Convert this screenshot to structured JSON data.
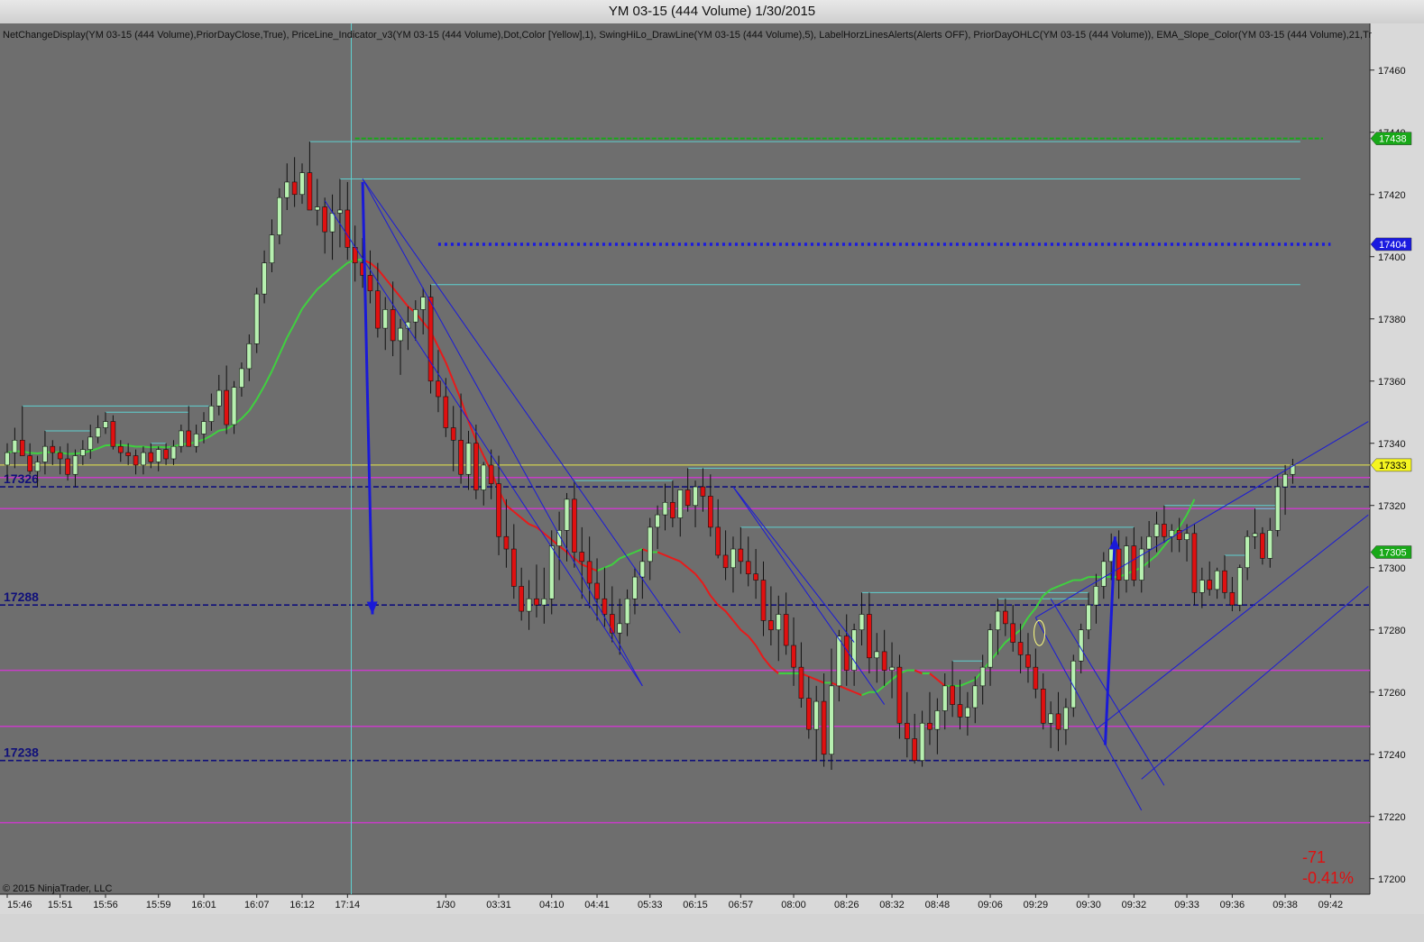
{
  "window": {
    "title": "YM 03-15 (444 Volume)  1/30/2015"
  },
  "indicator_label": "NetChangeDisplay(YM 03-15 (444 Volume),PriorDayClose,True), PriceLine_Indicator_v3(YM 03-15 (444 Volume),Dot,Color [Yellow],1), SwingHiLo_DrawLine(YM 03-15 (444 Volume),5), LabelHorzLinesAlerts(Alerts OFF), PriorDayOHLC(YM 03-15 (444 Volume)), EMA_Slope_Color(YM 03-15 (444 Volume),21,Tr",
  "copyright": "© 2015 NinjaTrader, LLC",
  "net_change": {
    "points": "-71",
    "percent": "-0.41%"
  },
  "colors": {
    "background": "#6e6e6e",
    "up_candle": "#b7f0b0",
    "down_candle": "#e01010",
    "wick": "#111111",
    "ema_up": "#3fd13f",
    "ema_down": "#e81a1a",
    "level_line": "#10107a",
    "prior_day": "#c83cc8",
    "swing": "#5fd0d0",
    "channel": "#1a1ad8",
    "price_line": "#e8e84a",
    "green_dash": "#18a818",
    "blue_dot": "#1a1ae0"
  },
  "chart_data": {
    "type": "candlestick",
    "title": "YM 03-15 (444 Volume)  1/30/2015",
    "ylim": [
      17195,
      17475
    ],
    "y_ticks": [
      17200,
      17220,
      17240,
      17260,
      17280,
      17300,
      17320,
      17340,
      17360,
      17380,
      17400,
      17420,
      17440,
      17460
    ],
    "x_labels": [
      {
        "i": 0,
        "label": "15:46"
      },
      {
        "i": 7,
        "label": "15:51"
      },
      {
        "i": 13,
        "label": "15:56"
      },
      {
        "i": 20,
        "label": "15:59"
      },
      {
        "i": 26,
        "label": "16:01"
      },
      {
        "i": 33,
        "label": "16:07"
      },
      {
        "i": 39,
        "label": "16:12"
      },
      {
        "i": 45,
        "label": "17:14"
      },
      {
        "i": 58,
        "label": "1/30"
      },
      {
        "i": 65,
        "label": "03:31"
      },
      {
        "i": 72,
        "label": "04:10"
      },
      {
        "i": 78,
        "label": "04:41"
      },
      {
        "i": 85,
        "label": "05:33"
      },
      {
        "i": 91,
        "label": "06:15"
      },
      {
        "i": 97,
        "label": "06:57"
      },
      {
        "i": 104,
        "label": "08:00"
      },
      {
        "i": 111,
        "label": "08:26"
      },
      {
        "i": 117,
        "label": "08:32"
      },
      {
        "i": 123,
        "label": "08:48"
      },
      {
        "i": 130,
        "label": "09:06"
      },
      {
        "i": 136,
        "label": "09:29"
      },
      {
        "i": 143,
        "label": "09:30"
      },
      {
        "i": 149,
        "label": "09:32"
      },
      {
        "i": 156,
        "label": "09:33"
      },
      {
        "i": 162,
        "label": "09:36"
      },
      {
        "i": 169,
        "label": "09:38"
      },
      {
        "i": 175,
        "label": "09:42"
      }
    ],
    "candles": [
      [
        17333,
        17340,
        17328,
        17337
      ],
      [
        17337,
        17345,
        17332,
        17341
      ],
      [
        17341,
        17352,
        17338,
        17336
      ],
      [
        17336,
        17340,
        17330,
        17331
      ],
      [
        17331,
        17336,
        17326,
        17334
      ],
      [
        17334,
        17344,
        17330,
        17339
      ],
      [
        17339,
        17341,
        17333,
        17337
      ],
      [
        17337,
        17339,
        17330,
        17335
      ],
      [
        17335,
        17340,
        17328,
        17330
      ],
      [
        17330,
        17338,
        17326,
        17336
      ],
      [
        17336,
        17341,
        17333,
        17338
      ],
      [
        17338,
        17346,
        17335,
        17342
      ],
      [
        17342,
        17349,
        17340,
        17345
      ],
      [
        17345,
        17350,
        17343,
        17347
      ],
      [
        17347,
        17349,
        17338,
        17339
      ],
      [
        17339,
        17341,
        17334,
        17337
      ],
      [
        17337,
        17340,
        17333,
        17336
      ],
      [
        17336,
        17338,
        17330,
        17333
      ],
      [
        17333,
        17339,
        17330,
        17337
      ],
      [
        17337,
        17340,
        17332,
        17334
      ],
      [
        17334,
        17339,
        17331,
        17338
      ],
      [
        17338,
        17340,
        17333,
        17335
      ],
      [
        17335,
        17341,
        17333,
        17339
      ],
      [
        17339,
        17346,
        17337,
        17344
      ],
      [
        17344,
        17352,
        17341,
        17339
      ],
      [
        17339,
        17346,
        17337,
        17343
      ],
      [
        17343,
        17350,
        17340,
        17347
      ],
      [
        17347,
        17356,
        17344,
        17352
      ],
      [
        17352,
        17362,
        17349,
        17357
      ],
      [
        17357,
        17365,
        17343,
        17346
      ],
      [
        17346,
        17360,
        17343,
        17358
      ],
      [
        17358,
        17366,
        17355,
        17364
      ],
      [
        17364,
        17375,
        17360,
        17372
      ],
      [
        17372,
        17390,
        17369,
        17388
      ],
      [
        17388,
        17402,
        17385,
        17398
      ],
      [
        17398,
        17412,
        17395,
        17407
      ],
      [
        17407,
        17422,
        17404,
        17419
      ],
      [
        17419,
        17430,
        17415,
        17424
      ],
      [
        17424,
        17432,
        17416,
        17420
      ],
      [
        17420,
        17430,
        17417,
        17427
      ],
      [
        17427,
        17437,
        17420,
        17415
      ],
      [
        17415,
        17425,
        17410,
        17416
      ],
      [
        17416,
        17419,
        17401,
        17408
      ],
      [
        17408,
        17420,
        17399,
        17414
      ],
      [
        17414,
        17425,
        17403,
        17415
      ],
      [
        17415,
        17424,
        17399,
        17403
      ],
      [
        17403,
        17410,
        17392,
        17398
      ],
      [
        17398,
        17406,
        17390,
        17394
      ],
      [
        17394,
        17402,
        17385,
        17389
      ],
      [
        17389,
        17398,
        17374,
        17377
      ],
      [
        17377,
        17387,
        17370,
        17383
      ],
      [
        17383,
        17392,
        17368,
        17373
      ],
      [
        17373,
        17380,
        17362,
        17377
      ],
      [
        17377,
        17384,
        17370,
        17379
      ],
      [
        17379,
        17386,
        17373,
        17383
      ],
      [
        17383,
        17390,
        17375,
        17387
      ],
      [
        17387,
        17391,
        17356,
        17360
      ],
      [
        17360,
        17370,
        17350,
        17355
      ],
      [
        17355,
        17361,
        17342,
        17345
      ],
      [
        17345,
        17352,
        17331,
        17341
      ],
      [
        17341,
        17356,
        17327,
        17330
      ],
      [
        17330,
        17344,
        17325,
        17340
      ],
      [
        17340,
        17346,
        17322,
        17325
      ],
      [
        17325,
        17334,
        17320,
        17333
      ],
      [
        17333,
        17338,
        17322,
        17327
      ],
      [
        17327,
        17336,
        17304,
        17310
      ],
      [
        17310,
        17322,
        17300,
        17306
      ],
      [
        17306,
        17314,
        17290,
        17294
      ],
      [
        17294,
        17300,
        17283,
        17286
      ],
      [
        17286,
        17296,
        17280,
        17290
      ],
      [
        17290,
        17301,
        17284,
        17288
      ],
      [
        17288,
        17300,
        17282,
        17290
      ],
      [
        17290,
        17312,
        17285,
        17307
      ],
      [
        17307,
        17318,
        17296,
        17312
      ],
      [
        17312,
        17324,
        17302,
        17322
      ],
      [
        17322,
        17328,
        17300,
        17305
      ],
      [
        17305,
        17313,
        17290,
        17302
      ],
      [
        17302,
        17310,
        17287,
        17295
      ],
      [
        17295,
        17303,
        17283,
        17290
      ],
      [
        17290,
        17300,
        17281,
        17285
      ],
      [
        17285,
        17294,
        17276,
        17279
      ],
      [
        17279,
        17290,
        17272,
        17282
      ],
      [
        17282,
        17293,
        17278,
        17290
      ],
      [
        17290,
        17300,
        17285,
        17297
      ],
      [
        17297,
        17306,
        17290,
        17302
      ],
      [
        17302,
        17316,
        17296,
        17313
      ],
      [
        17313,
        17320,
        17306,
        17317
      ],
      [
        17317,
        17327,
        17312,
        17321
      ],
      [
        17321,
        17328,
        17313,
        17316
      ],
      [
        17316,
        17325,
        17310,
        17325
      ],
      [
        17325,
        17332,
        17318,
        17320
      ],
      [
        17320,
        17328,
        17313,
        17326
      ],
      [
        17326,
        17332,
        17318,
        17323
      ],
      [
        17323,
        17330,
        17310,
        17313
      ],
      [
        17313,
        17322,
        17303,
        17304
      ],
      [
        17304,
        17312,
        17296,
        17300
      ],
      [
        17300,
        17310,
        17292,
        17306
      ],
      [
        17306,
        17313,
        17298,
        17302
      ],
      [
        17302,
        17310,
        17294,
        17298
      ],
      [
        17298,
        17306,
        17290,
        17296
      ],
      [
        17296,
        17302,
        17278,
        17283
      ],
      [
        17283,
        17294,
        17275,
        17280
      ],
      [
        17280,
        17291,
        17270,
        17285
      ],
      [
        17285,
        17292,
        17272,
        17275
      ],
      [
        17275,
        17284,
        17262,
        17268
      ],
      [
        17268,
        17276,
        17255,
        17258
      ],
      [
        17258,
        17265,
        17245,
        17248
      ],
      [
        17248,
        17262,
        17238,
        17257
      ],
      [
        17257,
        17266,
        17236,
        17240
      ],
      [
        17240,
        17274,
        17235,
        17262
      ],
      [
        17262,
        17280,
        17257,
        17278
      ],
      [
        17278,
        17285,
        17262,
        17267
      ],
      [
        17267,
        17282,
        17262,
        17280
      ],
      [
        17280,
        17292,
        17275,
        17285
      ],
      [
        17285,
        17292,
        17266,
        17271
      ],
      [
        17271,
        17279,
        17263,
        17273
      ],
      [
        17273,
        17280,
        17262,
        17267
      ],
      [
        17267,
        17276,
        17258,
        17268
      ],
      [
        17268,
        17272,
        17245,
        17250
      ],
      [
        17250,
        17260,
        17239,
        17245
      ],
      [
        17245,
        17253,
        17237,
        17238
      ],
      [
        17238,
        17254,
        17236,
        17250
      ],
      [
        17250,
        17260,
        17243,
        17248
      ],
      [
        17248,
        17258,
        17240,
        17254
      ],
      [
        17254,
        17266,
        17248,
        17262
      ],
      [
        17262,
        17270,
        17252,
        17256
      ],
      [
        17256,
        17264,
        17248,
        17252
      ],
      [
        17252,
        17260,
        17246,
        17255
      ],
      [
        17255,
        17265,
        17250,
        17262
      ],
      [
        17262,
        17272,
        17256,
        17268
      ],
      [
        17268,
        17282,
        17262,
        17280
      ],
      [
        17280,
        17290,
        17272,
        17286
      ],
      [
        17286,
        17290,
        17278,
        17282
      ],
      [
        17282,
        17288,
        17273,
        17276
      ],
      [
        17276,
        17282,
        17266,
        17272
      ],
      [
        17272,
        17279,
        17263,
        17268
      ],
      [
        17268,
        17274,
        17258,
        17261
      ],
      [
        17261,
        17266,
        17248,
        17250
      ],
      [
        17250,
        17257,
        17242,
        17253
      ],
      [
        17253,
        17260,
        17241,
        17248
      ],
      [
        17248,
        17258,
        17243,
        17255
      ],
      [
        17255,
        17272,
        17252,
        17270
      ],
      [
        17270,
        17282,
        17266,
        17280
      ],
      [
        17280,
        17292,
        17277,
        17288
      ],
      [
        17288,
        17298,
        17282,
        17294
      ],
      [
        17294,
        17305,
        17290,
        17302
      ],
      [
        17302,
        17311,
        17296,
        17306
      ],
      [
        17306,
        17312,
        17290,
        17296
      ],
      [
        17296,
        17310,
        17292,
        17307
      ],
      [
        17307,
        17313,
        17294,
        17296
      ],
      [
        17296,
        17310,
        17292,
        17306
      ],
      [
        17306,
        17315,
        17300,
        17310
      ],
      [
        17310,
        17318,
        17305,
        17314
      ],
      [
        17314,
        17320,
        17308,
        17310
      ],
      [
        17310,
        17314,
        17305,
        17312
      ],
      [
        17312,
        17316,
        17305,
        17309
      ],
      [
        17309,
        17314,
        17302,
        17311
      ],
      [
        17311,
        17314,
        17288,
        17292
      ],
      [
        17292,
        17300,
        17287,
        17296
      ],
      [
        17296,
        17302,
        17291,
        17293
      ],
      [
        17293,
        17300,
        17290,
        17299
      ],
      [
        17299,
        17304,
        17290,
        17292
      ],
      [
        17292,
        17297,
        17286,
        17288
      ],
      [
        17288,
        17301,
        17286,
        17300
      ],
      [
        17300,
        17312,
        17296,
        17310
      ],
      [
        17310,
        17319,
        17306,
        17311
      ],
      [
        17311,
        17313,
        17301,
        17303
      ],
      [
        17303,
        17316,
        17300,
        17312
      ],
      [
        17312,
        17330,
        17310,
        17326
      ],
      [
        17326,
        17333,
        17317,
        17330
      ],
      [
        17330,
        17335,
        17327,
        17333
      ]
    ],
    "ema": {
      "start": 43,
      "values": [
        17394,
        17396,
        17398,
        17399,
        17399,
        17398,
        17396,
        17393,
        17390,
        17387,
        17384,
        17382,
        17379,
        17376,
        17371,
        17366,
        17360,
        17354,
        17347,
        17341,
        17336,
        17331,
        17325,
        17320,
        17318,
        17316,
        17314,
        17313,
        17311,
        17309,
        17307,
        17305,
        17303,
        17301,
        17300,
        17299,
        17300,
        17301,
        17303,
        17304,
        17305,
        17306,
        17305,
        17305,
        17304,
        17303,
        17302,
        17300,
        17298,
        17295,
        17291,
        17288,
        17286,
        17283,
        17280,
        17278,
        17275,
        17271,
        17268,
        17266,
        17266,
        17266,
        17266,
        17265,
        17264,
        17263,
        17263,
        17262,
        17261,
        17260,
        17259,
        17260,
        17260,
        17262,
        17264,
        17266,
        17267,
        17267,
        17266,
        17266,
        17264,
        17262,
        17262,
        17262,
        17263,
        17264,
        17267,
        17270,
        17273,
        17276,
        17278,
        17280,
        17284,
        17287,
        17291,
        17293,
        17294,
        17295,
        17296,
        17296,
        17297,
        17297,
        17297,
        17297,
        17297,
        17298,
        17299,
        17300,
        17302,
        17304,
        17307,
        17310,
        17313,
        17317,
        17322
      ]
    },
    "levels": [
      {
        "price": 17326,
        "label": "17326"
      },
      {
        "price": 17288,
        "label": "17288"
      },
      {
        "price": 17238,
        "label": "17238"
      }
    ],
    "price_markers": [
      {
        "price": 17438,
        "label": "17438",
        "bg": "#18a818",
        "fg": "#ffffff"
      },
      {
        "price": 17404,
        "label": "17404",
        "bg": "#1a1ae0",
        "fg": "#ffffff"
      },
      {
        "price": 17333,
        "label": "17333",
        "bg": "#f5f520",
        "fg": "#000000"
      },
      {
        "price": 17305,
        "label": "17305",
        "bg": "#18a818",
        "fg": "#ffffff"
      }
    ],
    "current_price": 17333,
    "prior_day_lines": [
      17329,
      17319,
      17267,
      17249,
      17218
    ],
    "green_dashed_line": 17438,
    "blue_dotted_line": 17404
  }
}
